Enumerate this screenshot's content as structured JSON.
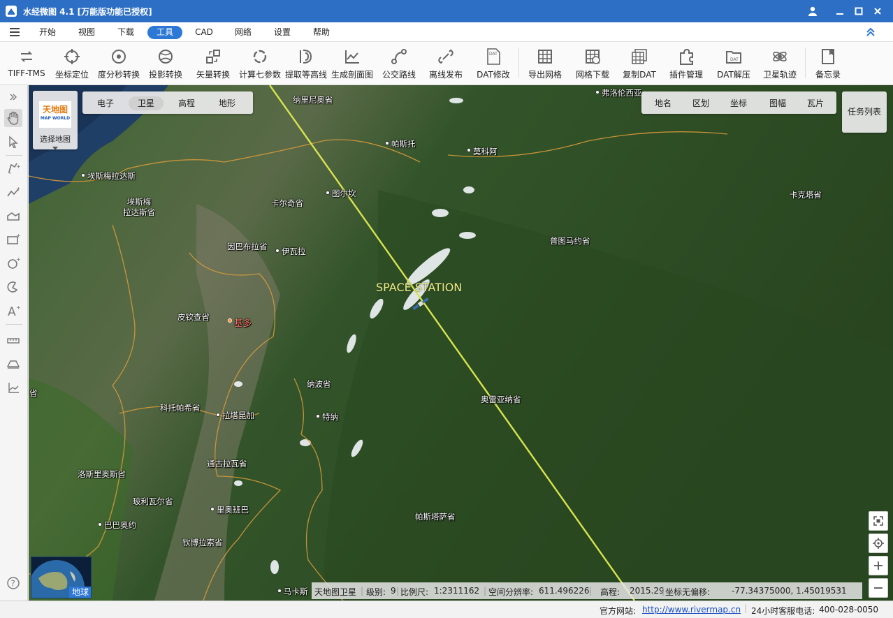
{
  "app": {
    "title": "水经微图 4.1 [万能版功能已授权]"
  },
  "colors": {
    "title_bar": "#2d6fc4",
    "active_tab": "#2d77d6",
    "orbit_line": "#d7e44e",
    "capital_label": "#ff7b6b"
  },
  "menu": {
    "items": [
      "开始",
      "视图",
      "下载",
      "工具",
      "CAD",
      "网络",
      "设置",
      "帮助"
    ],
    "active": "工具"
  },
  "toolbar": {
    "tools": [
      {
        "label": "TIFF-TMS",
        "icon": "tiff-tms-icon"
      },
      {
        "label": "坐标定位",
        "icon": "crosshair-icon"
      },
      {
        "label": "度分秒转换",
        "icon": "dms-convert-icon"
      },
      {
        "label": "投影转换",
        "icon": "projection-icon"
      },
      {
        "label": "矢量转换",
        "icon": "vector-convert-icon"
      },
      {
        "label": "计算七参数",
        "icon": "seven-params-icon"
      },
      {
        "label": "提取等高线",
        "icon": "contour-icon"
      },
      {
        "label": "生成剖面图",
        "icon": "profile-icon"
      },
      {
        "label": "公交路线",
        "icon": "bus-route-icon"
      },
      {
        "label": "离线发布",
        "icon": "offline-publish-icon"
      },
      {
        "label": "DAT修改",
        "icon": "dat-edit-icon"
      },
      {
        "label": "导出网格",
        "icon": "grid-export-icon"
      },
      {
        "label": "网格下载",
        "icon": "grid-download-icon"
      },
      {
        "label": "复制DAT",
        "icon": "copy-dat-icon"
      },
      {
        "label": "插件管理",
        "icon": "puzzle-icon"
      },
      {
        "label": "DAT解压",
        "icon": "dat-unzip-icon"
      },
      {
        "label": "卫星轨迹",
        "icon": "satellite-icon"
      },
      {
        "label": "备忘录",
        "icon": "memo-icon"
      }
    ]
  },
  "map_source": {
    "logo_text": "天地图",
    "logo_subtext": "MAP WORLD",
    "label": "选择地图"
  },
  "map_type": {
    "items": [
      "电子",
      "卫星",
      "高程",
      "地形"
    ],
    "active": "卫星"
  },
  "overlays": {
    "items": [
      "地名",
      "区划",
      "坐标",
      "图幅",
      "瓦片"
    ]
  },
  "task_list": {
    "label": "任务列表"
  },
  "satellite": {
    "name": "SPACE STATION"
  },
  "places": [
    {
      "name": "纳里尼奥省",
      "dot": false
    },
    {
      "name": "弗洛伦西亚",
      "dot": true
    },
    {
      "name": "帕斯托",
      "dot": true
    },
    {
      "name": "莫科阿",
      "dot": true
    },
    {
      "name": "埃斯梅拉达斯",
      "dot": true
    },
    {
      "name": "埃斯梅\n拉达斯省",
      "dot": false
    },
    {
      "name": "图尔坎",
      "dot": true
    },
    {
      "name": "卡尔奇省",
      "dot": false
    },
    {
      "name": "卡克塔省",
      "dot": false
    },
    {
      "name": "因巴布拉省",
      "dot": false
    },
    {
      "name": "伊瓦拉",
      "dot": true
    },
    {
      "name": "普图马约省",
      "dot": false
    },
    {
      "name": "皮钦查省",
      "dot": false
    },
    {
      "name": "基多",
      "dot": true,
      "capital": true
    },
    {
      "name": "纳波省",
      "dot": false
    },
    {
      "name": "科托帕希省",
      "dot": false
    },
    {
      "name": "拉塔昆加",
      "dot": true
    },
    {
      "name": "特纳",
      "dot": true
    },
    {
      "name": "奥雷亚纳省",
      "dot": false
    },
    {
      "name": "通古拉瓦省",
      "dot": false
    },
    {
      "name": "洛斯里奥斯省",
      "dot": false
    },
    {
      "name": "玻利瓦尔省",
      "dot": false
    },
    {
      "name": "里奥班巴",
      "dot": true
    },
    {
      "name": "巴巴奥约",
      "dot": true
    },
    {
      "name": "帕斯塔萨省",
      "dot": false
    },
    {
      "name": "钦博拉索省",
      "dot": false
    },
    {
      "name": "马卡斯",
      "dot": true
    },
    {
      "name": "省",
      "dot": false
    }
  ],
  "minimap": {
    "label": "地球"
  },
  "status": {
    "source": "天地图卫星",
    "level_label": "级别:",
    "level": "9",
    "scale_label": "比例尺:",
    "scale": "1:2311162",
    "resolution_label": "空间分辨率:",
    "resolution": "611.496226",
    "elevation_label": "高程:",
    "elevation": "2015.29",
    "coord_label": "坐标无偏移:",
    "coords": "-77.34375000, 1.45019531"
  },
  "footer": {
    "website_label": "官方网站:",
    "website_url": "http://www.rivermap.cn",
    "phone_label": "24小时客服电话:",
    "phone": "400-028-0050"
  }
}
